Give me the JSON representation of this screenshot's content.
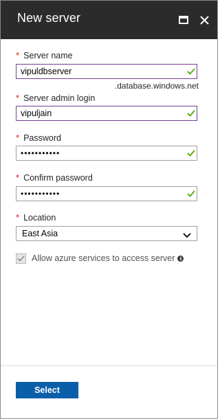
{
  "header": {
    "title": "New server",
    "maximize_icon": "maximize-icon",
    "close_icon": "close-icon"
  },
  "form": {
    "server_name": {
      "label": "Server name",
      "required": "*",
      "value": "vipuldbserver",
      "suffix": ".database.windows.net",
      "valid": true
    },
    "admin_login": {
      "label": "Server admin login",
      "required": "*",
      "value": "vipuljain",
      "valid": true
    },
    "password": {
      "label": "Password",
      "required": "*",
      "value": "•••••••••••",
      "valid": true
    },
    "confirm_password": {
      "label": "Confirm password",
      "required": "*",
      "value": "•••••••••••",
      "valid": true
    },
    "location": {
      "label": "Location",
      "required": "*",
      "value": "East Asia"
    },
    "allow_azure": {
      "label": "Allow azure services to access server",
      "checked": true,
      "info_icon": "info-icon",
      "info_glyph": "i"
    }
  },
  "footer": {
    "select_label": "Select"
  },
  "colors": {
    "header_bg": "#2b2b2b",
    "required": "#d81e05",
    "valid_check": "#5cae1a",
    "focus_border": "#7a3d8f",
    "primary_button": "#0b5fa8"
  }
}
